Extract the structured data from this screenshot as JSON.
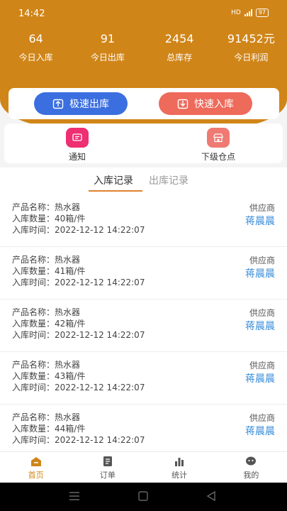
{
  "status": {
    "time": "14:42",
    "network": "HD",
    "battery": "97"
  },
  "stats": [
    {
      "value": "64",
      "label": "今日入库"
    },
    {
      "value": "91",
      "label": "今日出库"
    },
    {
      "value": "2454",
      "label": "总库存"
    },
    {
      "value": "91452元",
      "label": "今日利润"
    }
  ],
  "actions": {
    "out_label": "极速出库",
    "in_label": "快速入库"
  },
  "quick": {
    "notice_label": "通知",
    "sub_label": "下级仓点"
  },
  "tabs": {
    "in_records": "入库记录",
    "out_records": "出库记录"
  },
  "records": [
    {
      "name": "产品名称：热水器",
      "qty": "入库数量：40箱/件",
      "time": "入库时间：2022-12-12 14:22:07",
      "supplier_label": "供应商",
      "supplier": "蒋晨晨"
    },
    {
      "name": "产品名称：热水器",
      "qty": "入库数量：41箱/件",
      "time": "入库时间：2022-12-12 14:22:07",
      "supplier_label": "供应商",
      "supplier": "蒋晨晨"
    },
    {
      "name": "产品名称：热水器",
      "qty": "入库数量：42箱/件",
      "time": "入库时间：2022-12-12 14:22:07",
      "supplier_label": "供应商",
      "supplier": "蒋晨晨"
    },
    {
      "name": "产品名称：热水器",
      "qty": "入库数量：43箱/件",
      "time": "入库时间：2022-12-12 14:22:07",
      "supplier_label": "供应商",
      "supplier": "蒋晨晨"
    },
    {
      "name": "产品名称：热水器",
      "qty": "入库数量：44箱/件",
      "time": "入库时间：2022-12-12 14:22:07",
      "supplier_label": "供应商",
      "supplier": "蒋晨晨"
    }
  ],
  "tabbar": {
    "home": "首页",
    "orders": "订单",
    "stats": "统计",
    "mine": "我的"
  },
  "colors": {
    "accent": "#d08518",
    "primary_button": "#3b6fe0",
    "secondary_button": "#ee6a5b",
    "link": "#3a8ed9"
  }
}
